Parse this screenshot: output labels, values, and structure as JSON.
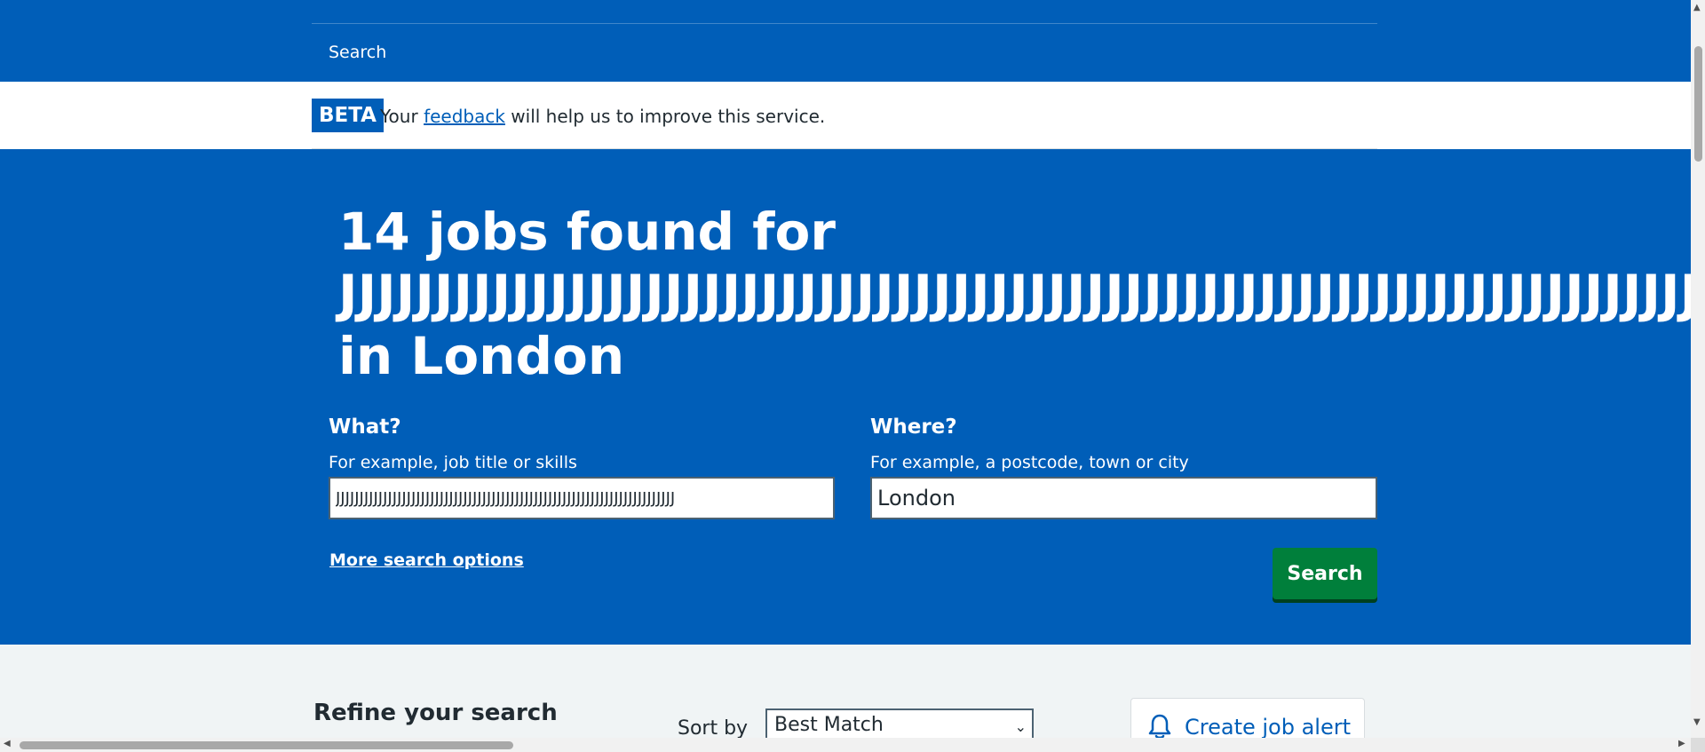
{
  "header": {
    "nav_search_label": "Search"
  },
  "beta_banner": {
    "tag": "BETA",
    "text_before": "Your ",
    "link_text": "feedback",
    "text_after": " will help us to improve this service."
  },
  "results": {
    "heading_line1": "14 jobs found for",
    "heading_line2": "JJJJJJJJJJJJJJJJJJJJJJJJJJJJJJJJJJJJJJJJJJJJJJJJJJJJJJJJJJJJJJJJJJJJJJJJJJJJJJJJJJJJJJJJJJJJJJJJJJJJJJJJJJJJJJJJJJJJJJJJJJJJJJJJJJJ",
    "heading_line3": "in London"
  },
  "search_form": {
    "what_label": "What?",
    "what_hint": "For example, job title or skills",
    "what_value": "JJJJJJJJJJJJJJJJJJJJJJJJJJJJJJJJJJJJJJJJJJJJJJJJJJJJJJJJJJJJJJJJJJJJJJJJ",
    "where_label": "Where?",
    "where_hint": "For example, a postcode, town or city",
    "where_value": "London",
    "more_options_link": "More search options",
    "search_button": "Search"
  },
  "filters": {
    "refine_heading": "Refine your search",
    "sort_label": "Sort by",
    "sort_selected": "Best Match",
    "create_alert": "Create job alert"
  },
  "colors": {
    "brand_blue": "#005eb8",
    "button_green": "#007f3b",
    "page_grey": "#f0f4f5"
  },
  "icons": {
    "alert": "bell-icon",
    "select": "chevron-down-icon"
  }
}
